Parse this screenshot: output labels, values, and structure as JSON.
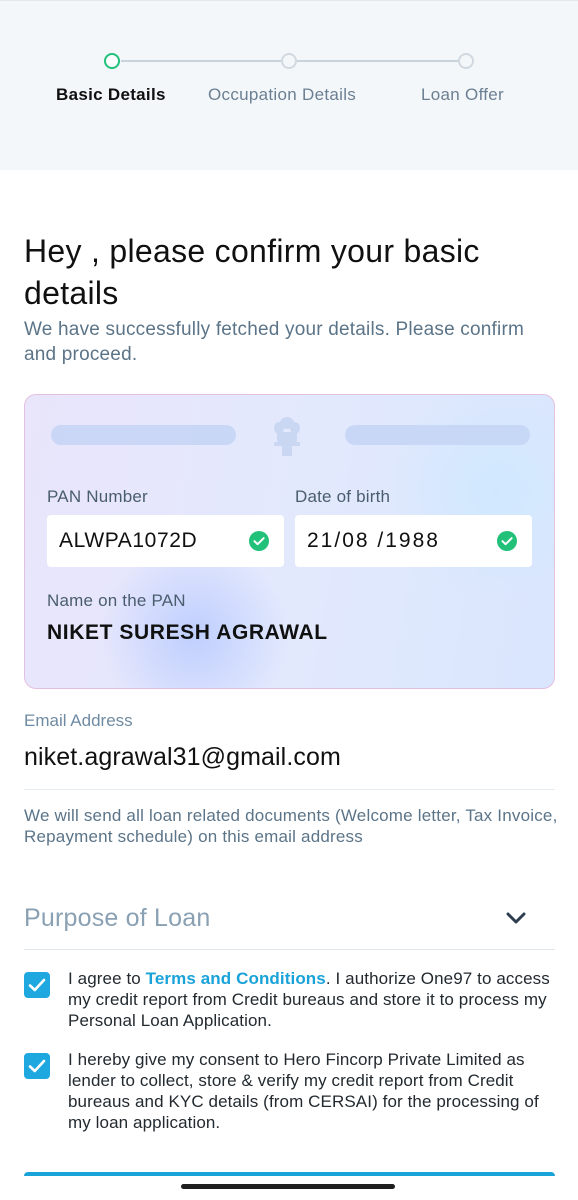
{
  "stepper": {
    "steps": [
      {
        "label": "Basic Details",
        "state": "active"
      },
      {
        "label": "Occupation Details",
        "state": "pending"
      },
      {
        "label": "Loan Offer",
        "state": "pending"
      }
    ]
  },
  "header": {
    "title": "Hey , please confirm your basic details",
    "subtitle": "We have successfully fetched your details. Please confirm and proceed."
  },
  "pan_card": {
    "pan_label": "PAN Number",
    "pan_value": "ALWPA1072D",
    "pan_verified": true,
    "dob_label": "Date of birth",
    "dob_value": "21/08 /1988",
    "dob_verified": true,
    "name_label": "Name on the PAN",
    "name_value": "NIKET SURESH AGRAWAL",
    "emblem_icon": "national-emblem-icon"
  },
  "email": {
    "label": "Email Address",
    "value": "niket.agrawal31@gmail.com",
    "note": "We will send all loan related documents (Welcome letter, Tax Invoice, Repayment schedule) on this email address"
  },
  "purpose": {
    "placeholder": "Purpose of Loan",
    "icon": "chevron-down-icon"
  },
  "consents": [
    {
      "checked": true,
      "prefix": "I agree to ",
      "link": "Terms and Conditions",
      "suffix": ". I authorize One97 to access my credit report from Credit bureaus and store it to process my Personal Loan Application."
    },
    {
      "checked": true,
      "text": "I hereby give my consent to Hero Fincorp Private Limited as lender to collect, store & verify my credit report from Credit bureaus and KYC details (from CERSAI) for the processing of my loan application."
    }
  ],
  "colors": {
    "accent": "#1aa3d8",
    "success": "#21c17a",
    "muted_text": "#5b7488",
    "card_border": "#e3bfe0"
  }
}
